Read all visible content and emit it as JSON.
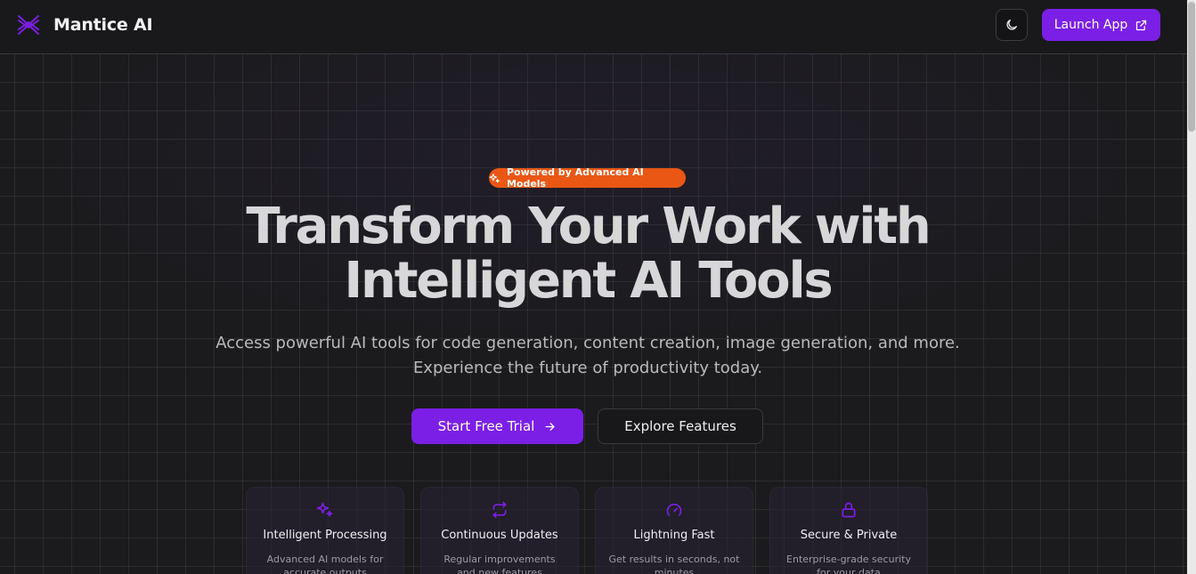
{
  "header": {
    "brand": "Mantice AI",
    "launch_label": "Launch App"
  },
  "hero": {
    "badge": "Powered by Advanced AI Models",
    "headline_line1": "Transform Your Work with",
    "headline_line2": "Intelligent AI Tools",
    "subtitle": "Access powerful AI tools for code generation, content creation, image generation, and more. Experience the future of productivity today.",
    "primary_cta": "Start Free Trial",
    "secondary_cta": "Explore Features"
  },
  "features": [
    {
      "title": "Intelligent Processing",
      "description": "Advanced AI models for accurate outputs",
      "icon": "sparkles-icon"
    },
    {
      "title": "Continuous Updates",
      "description": "Regular improvements and new features",
      "icon": "repeat-icon"
    },
    {
      "title": "Lightning Fast",
      "description": "Get results in seconds, not minutes",
      "icon": "gauge-icon"
    },
    {
      "title": "Secure & Private",
      "description": "Enterprise-grade security for your data",
      "icon": "lock-icon"
    }
  ],
  "colors": {
    "accent": "#7c1fe6",
    "badge": "#ea5714",
    "background": "#1b1b1e"
  }
}
